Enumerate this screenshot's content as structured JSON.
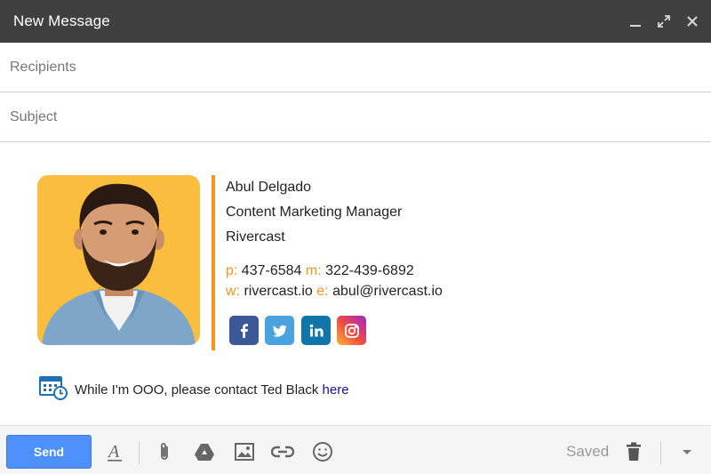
{
  "window": {
    "title": "New Message"
  },
  "recipients": {
    "placeholder": "Recipients"
  },
  "subject": {
    "placeholder": "Subject"
  },
  "signature": {
    "name": "Abul Delgado",
    "job_title": "Content Marketing Manager",
    "company": "Rivercast",
    "phone_label": "p:",
    "phone": "437-6584",
    "mobile_label": "m:",
    "mobile": "322-439-6892",
    "web_label": "w:",
    "web": "rivercast.io",
    "email_label": "e:",
    "email": "abul@rivercast.io",
    "accent_color": "#f7941d",
    "photo_bg_color": "#fbbd3e",
    "social": [
      {
        "icon": "facebook-icon",
        "color": "#3b5998"
      },
      {
        "icon": "twitter-icon",
        "color": "#4aa3df"
      },
      {
        "icon": "linkedin-icon",
        "color": "#0e76a8"
      },
      {
        "icon": "instagram-icon",
        "color": "#d6249f"
      }
    ]
  },
  "ooo": {
    "icon": "calendar-clock-icon",
    "text": "While I'm OOO, please contact Ted Black",
    "link": "here"
  },
  "toolbar": {
    "send_label": "Send",
    "saved_label": "Saved",
    "send_color": "#4d90fe",
    "icons": [
      "format-text-icon",
      "attach-icon",
      "drive-icon",
      "image-icon",
      "link-icon",
      "emoji-icon",
      "trash-icon",
      "more-options-icon"
    ]
  }
}
